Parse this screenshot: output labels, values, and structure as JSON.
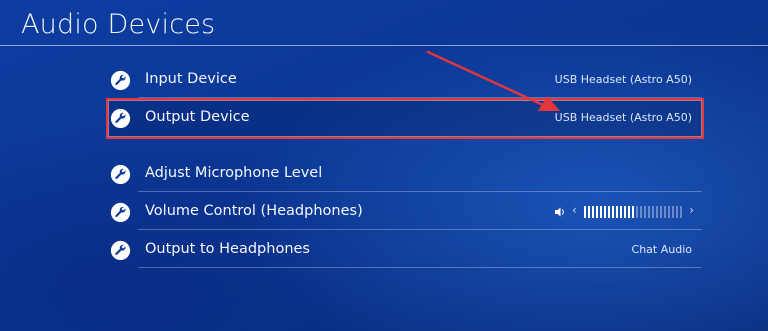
{
  "page": {
    "title": "Audio Devices"
  },
  "settings": [
    {
      "label": "Input Device",
      "value": "USB Headset (Astro A50)"
    },
    {
      "label": "Output Device",
      "value": "USB Headset (Astro A50)"
    },
    {
      "label": "Adjust Microphone Level",
      "value": ""
    },
    {
      "label": "Volume Control (Headphones)",
      "value": ""
    },
    {
      "label": "Output to Headphones",
      "value": "Chat Audio"
    }
  ],
  "volume": {
    "level_fraction": 0.5,
    "left_icon": "chevron-left-icon",
    "right_icon": "chevron-right-icon",
    "speaker_icon": "speaker-icon"
  },
  "icons": {
    "row_icon": "wrench-icon"
  },
  "annotation": {
    "highlight_color": "#e03a3e",
    "arrow_color": "#e0363c"
  }
}
